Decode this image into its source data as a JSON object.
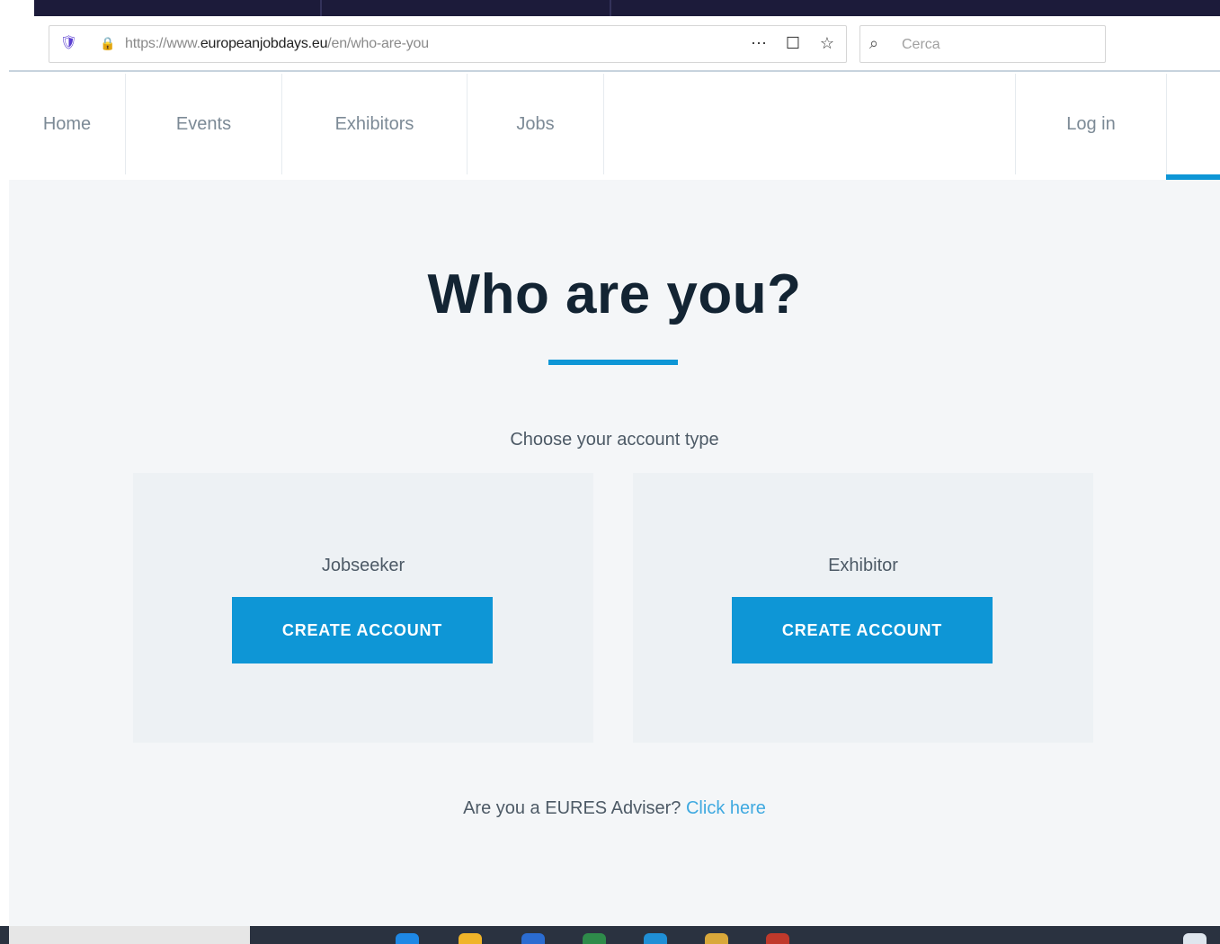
{
  "browser": {
    "url_prefix": "https://www.",
    "url_domain": "europeanjobdays.eu",
    "url_path": "/en/who-are-you",
    "search_placeholder": "Cerca",
    "shield_icon": "tracking-protection-icon",
    "lock_icon": "lock-icon",
    "page_actions_icon": "more-actions-icon",
    "pocket_icon": "pocket-icon",
    "bookmark_icon": "star-icon",
    "search_icon": "search-icon"
  },
  "nav": {
    "items": [
      {
        "label": "Home"
      },
      {
        "label": "Events"
      },
      {
        "label": "Exhibitors"
      },
      {
        "label": "Jobs"
      },
      {
        "label": "Log in"
      }
    ]
  },
  "main": {
    "title": "Who are you?",
    "subtitle": "Choose your account type",
    "cards": [
      {
        "label": "Jobseeker",
        "button": "CREATE ACCOUNT"
      },
      {
        "label": "Exhibitor",
        "button": "CREATE ACCOUNT"
      }
    ],
    "footer_text": "Are you a EURES Adviser?",
    "footer_link": "Click here"
  },
  "colors": {
    "accent": "#0e96d6",
    "title": "#132433",
    "page_bg": "#f4f6f8"
  }
}
